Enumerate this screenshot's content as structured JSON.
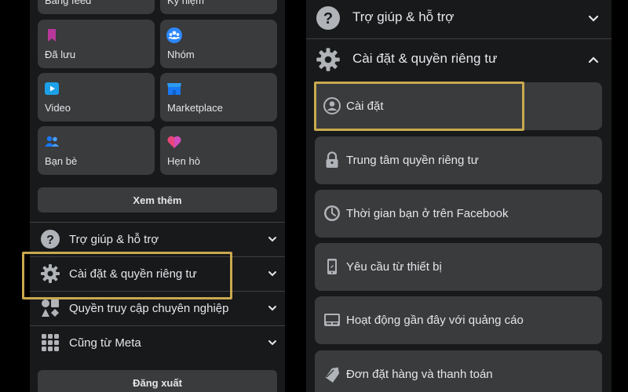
{
  "left": {
    "shortcuts": [
      {
        "label": "Bảng feed",
        "icon": "feed-icon"
      },
      {
        "label": "Kỷ niệm",
        "icon": "memories-icon"
      },
      {
        "label": "Đã lưu",
        "icon": "bookmark-icon"
      },
      {
        "label": "Nhóm",
        "icon": "groups-icon"
      },
      {
        "label": "Video",
        "icon": "video-icon"
      },
      {
        "label": "Marketplace",
        "icon": "marketplace-icon"
      },
      {
        "label": "Bạn bè",
        "icon": "friends-icon"
      },
      {
        "label": "Hẹn hò",
        "icon": "heart-icon"
      }
    ],
    "see_more_label": "Xem thêm",
    "menu": [
      {
        "label": "Trợ giúp & hỗ trợ",
        "icon": "help-icon"
      },
      {
        "label": "Cài đặt & quyền riêng tư",
        "icon": "gear-icon"
      },
      {
        "label": "Quyền truy cập chuyên nghiệp",
        "icon": "shapes-icon"
      },
      {
        "label": "Cũng từ Meta",
        "icon": "apps-grid-icon"
      }
    ],
    "logout_label": "Đăng xuất"
  },
  "right": {
    "help_label": "Trợ giúp & hỗ trợ",
    "settings_privacy_label": "Cài đặt & quyền riêng tư",
    "items": [
      {
        "label": "Cài đặt",
        "icon": "profile-circle-icon"
      },
      {
        "label": "Trung tâm quyền riêng tư",
        "icon": "lock-icon"
      },
      {
        "label": "Thời gian bạn ở trên Facebook",
        "icon": "clock-icon"
      },
      {
        "label": "Yêu cầu từ thiết bị",
        "icon": "phone-icon"
      },
      {
        "label": "Hoạt động gần đây với quảng cáo",
        "icon": "ad-activity-icon"
      },
      {
        "label": "Đơn đặt hàng và thanh toán",
        "icon": "tag-icon"
      }
    ]
  },
  "colors": {
    "background": "#000000",
    "panel": "#18191a",
    "card": "#3a3b3c",
    "text": "#e4e6eb",
    "highlight": "#c9a94f"
  }
}
